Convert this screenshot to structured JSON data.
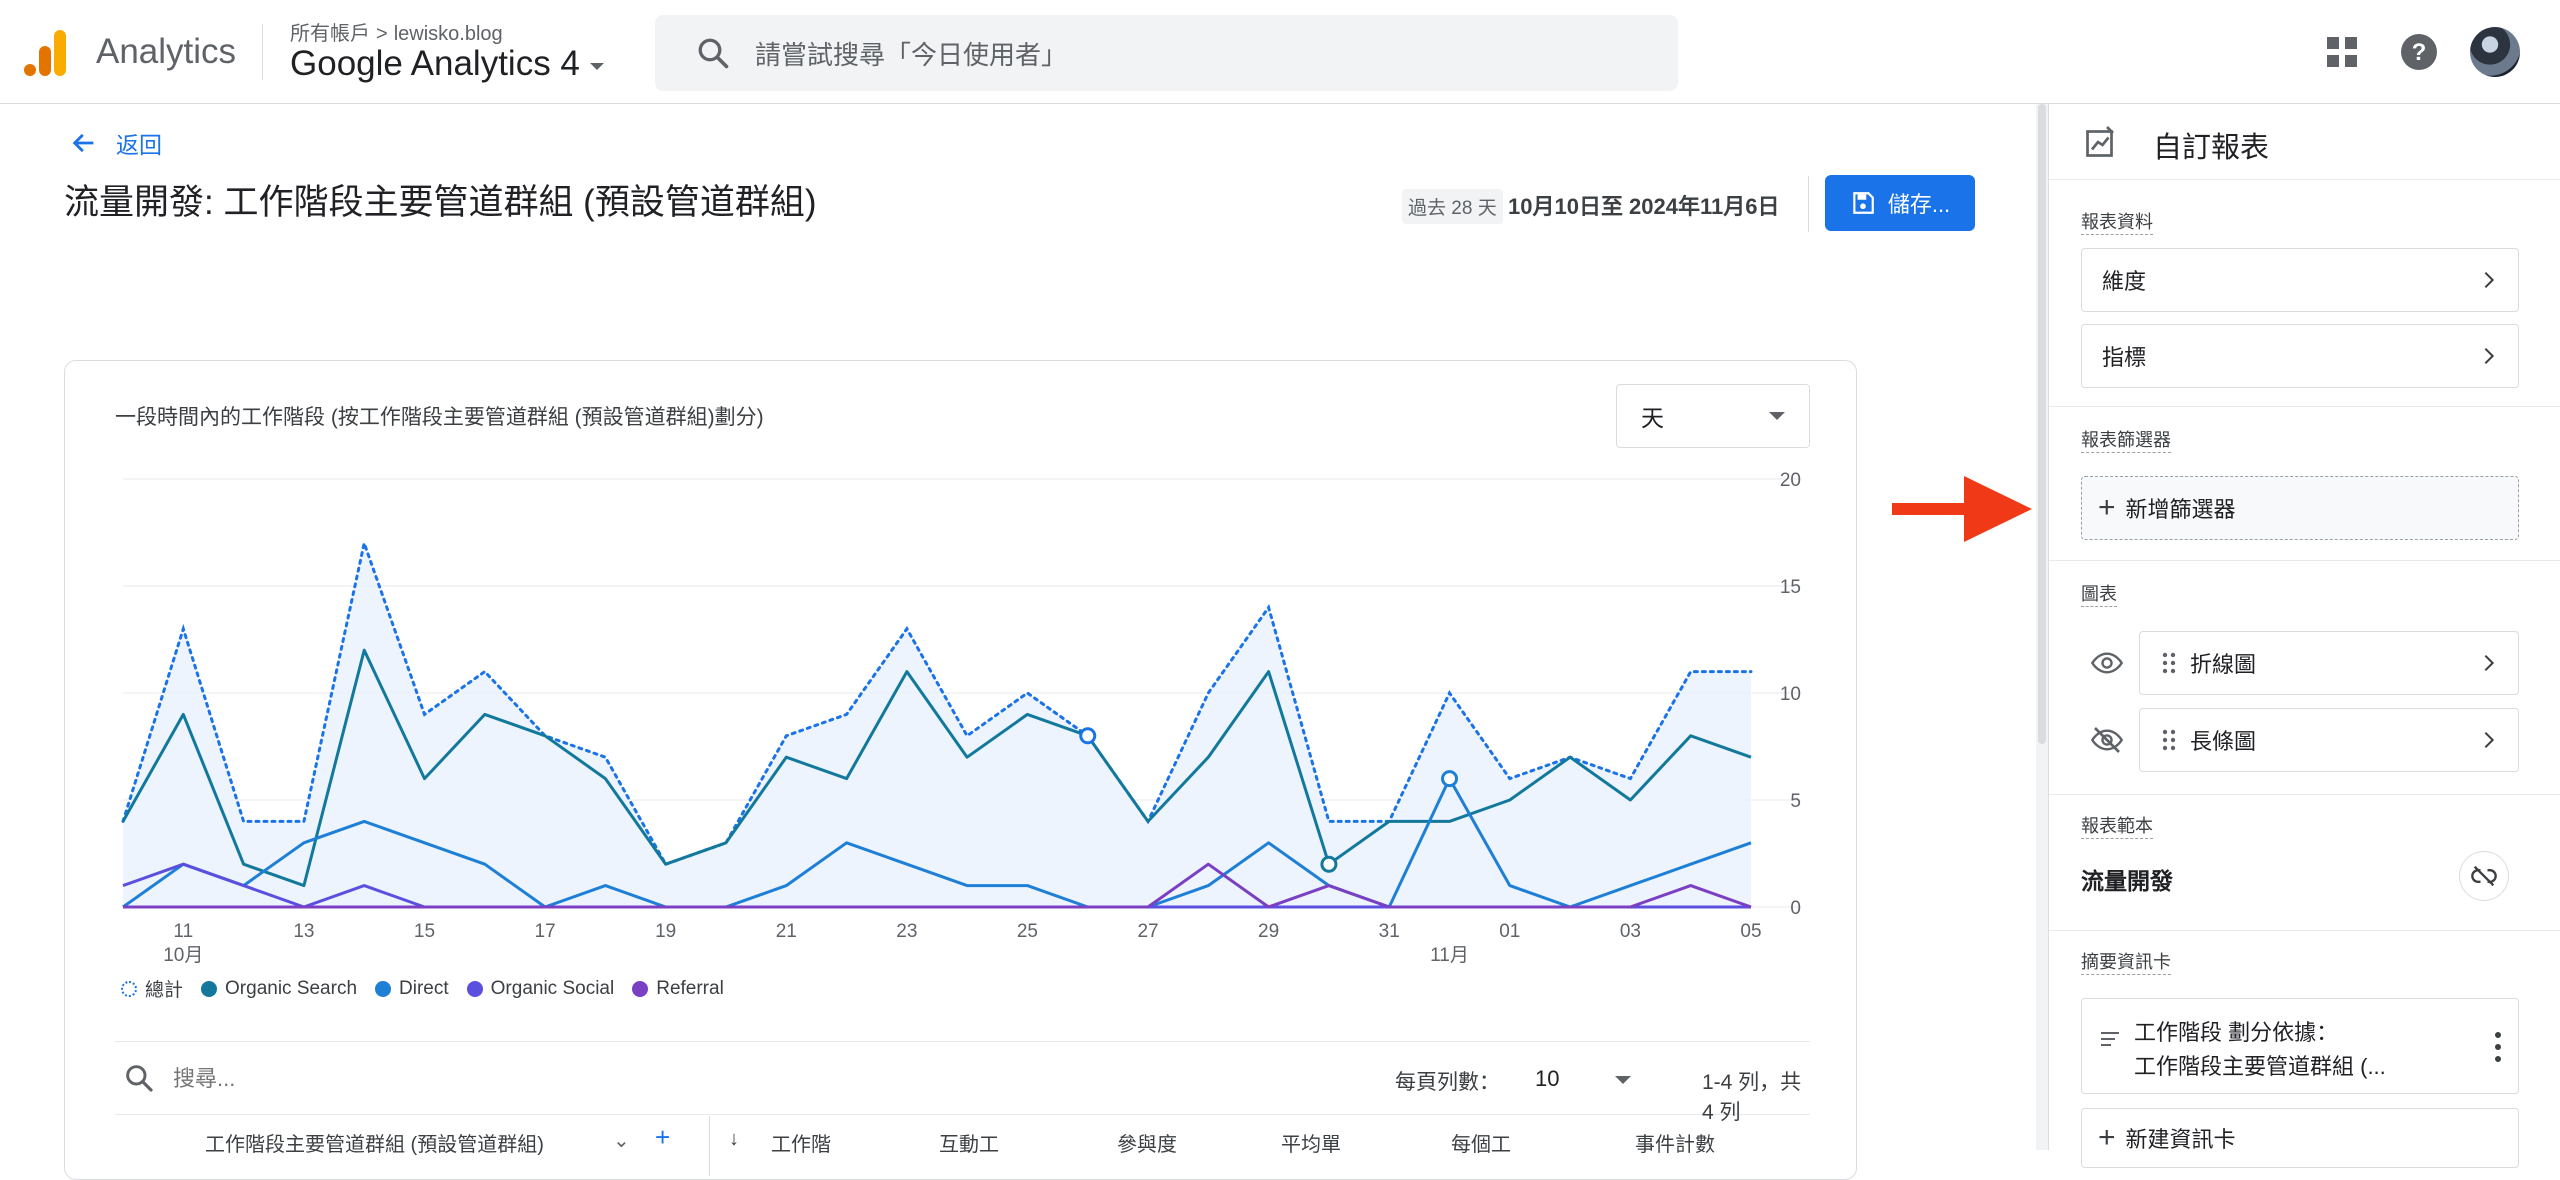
{
  "topbar": {
    "app_name": "Analytics",
    "account_parent": "所有帳戶",
    "account_name": "lewisko.blog",
    "property_name": "Google Analytics 4",
    "search_placeholder": "請嘗試搜尋「今日使用者」"
  },
  "main": {
    "back_label": "返回",
    "page_title": "流量開發: 工作階段主要管道群組 (預設管道群組)",
    "date_chip": "過去 28 天",
    "date_range": "10月10日至 2024年11月6日",
    "save_label": "儲存...",
    "chart_title": "一段時間內的工作階段 (按工作階段主要管道群組 (預設管道群組)劃分)",
    "granularity": "天",
    "table": {
      "search_placeholder": "搜尋...",
      "rows_per_page_label": "每頁列數：",
      "rows_per_page": "10",
      "row_count": "1-4 列，共 4 列",
      "headers": [
        "工作階段主要管道群組 (預設管道群組)",
        "工作階",
        "互動工",
        "參與度",
        "平均單",
        "每個工",
        "事件計數"
      ]
    }
  },
  "chart_data": {
    "type": "line",
    "x": [
      "10/10",
      "10/11",
      "10/12",
      "10/13",
      "10/14",
      "10/15",
      "10/16",
      "10/17",
      "10/18",
      "10/19",
      "10/20",
      "10/21",
      "10/22",
      "10/23",
      "10/24",
      "10/25",
      "10/26",
      "10/27",
      "10/28",
      "10/29",
      "10/30",
      "10/31",
      "11/01",
      "11/02",
      "11/03",
      "11/04",
      "11/05",
      "11/06"
    ],
    "x_tick_labels": [
      "11",
      "13",
      "15",
      "17",
      "19",
      "21",
      "23",
      "25",
      "27",
      "29",
      "31",
      "01",
      "03",
      "05"
    ],
    "month_labels": [
      "10月",
      "11月"
    ],
    "ylim": [
      0,
      20
    ],
    "y_ticks": [
      0,
      5,
      10,
      15,
      20
    ],
    "series": [
      {
        "name": "總計",
        "color": "#1a73e8",
        "style": "dotted-area",
        "values": [
          4,
          13,
          4,
          4,
          17,
          9,
          11,
          8,
          7,
          2,
          3,
          8,
          9,
          13,
          8,
          10,
          8,
          4,
          10,
          14,
          4,
          4,
          10,
          6,
          7,
          6,
          11,
          11
        ]
      },
      {
        "name": "Organic Search",
        "color": "#12799c",
        "style": "line",
        "values": [
          4,
          9,
          2,
          1,
          12,
          6,
          9,
          8,
          6,
          2,
          3,
          7,
          6,
          11,
          7,
          9,
          8,
          4,
          7,
          11,
          2,
          4,
          4,
          5,
          7,
          5,
          8,
          7
        ]
      },
      {
        "name": "Direct",
        "color": "#1e7fd6",
        "style": "line",
        "values": [
          0,
          2,
          1,
          3,
          4,
          3,
          2,
          0,
          1,
          0,
          0,
          1,
          3,
          2,
          1,
          1,
          0,
          0,
          1,
          3,
          1,
          0,
          6,
          1,
          0,
          1,
          2,
          3
        ]
      },
      {
        "name": "Organic Social",
        "color": "#5b4fe0",
        "style": "line",
        "values": [
          1,
          2,
          1,
          0,
          1,
          0,
          0,
          0,
          0,
          0,
          0,
          0,
          0,
          0,
          0,
          0,
          0,
          0,
          0,
          0,
          0,
          0,
          0,
          0,
          0,
          0,
          0,
          0
        ]
      },
      {
        "name": "Referral",
        "color": "#7b3fc4",
        "style": "line",
        "values": [
          0,
          0,
          0,
          0,
          0,
          0,
          0,
          0,
          0,
          0,
          0,
          0,
          0,
          0,
          0,
          0,
          0,
          0,
          2,
          0,
          1,
          0,
          0,
          0,
          0,
          0,
          1,
          0
        ]
      }
    ]
  },
  "panel": {
    "title": "自訂報表",
    "report_data_label": "報表資料",
    "dimensions": "維度",
    "metrics": "指標",
    "filters_label": "報表篩選器",
    "add_filter": "新增篩選器",
    "charts_label": "圖表",
    "line_chart": "折線圖",
    "bar_chart": "長條圖",
    "template_label": "報表範本",
    "template_name": "流量開發",
    "summary_label": "摘要資訊卡",
    "summary_line1": "工作階段 劃分依據：",
    "summary_line2": "工作階段主要管道群組 (...",
    "new_card": "新建資訊卡"
  },
  "colors": {
    "accent": "#1a73e8",
    "annotation_arrow": "#f03a17"
  }
}
